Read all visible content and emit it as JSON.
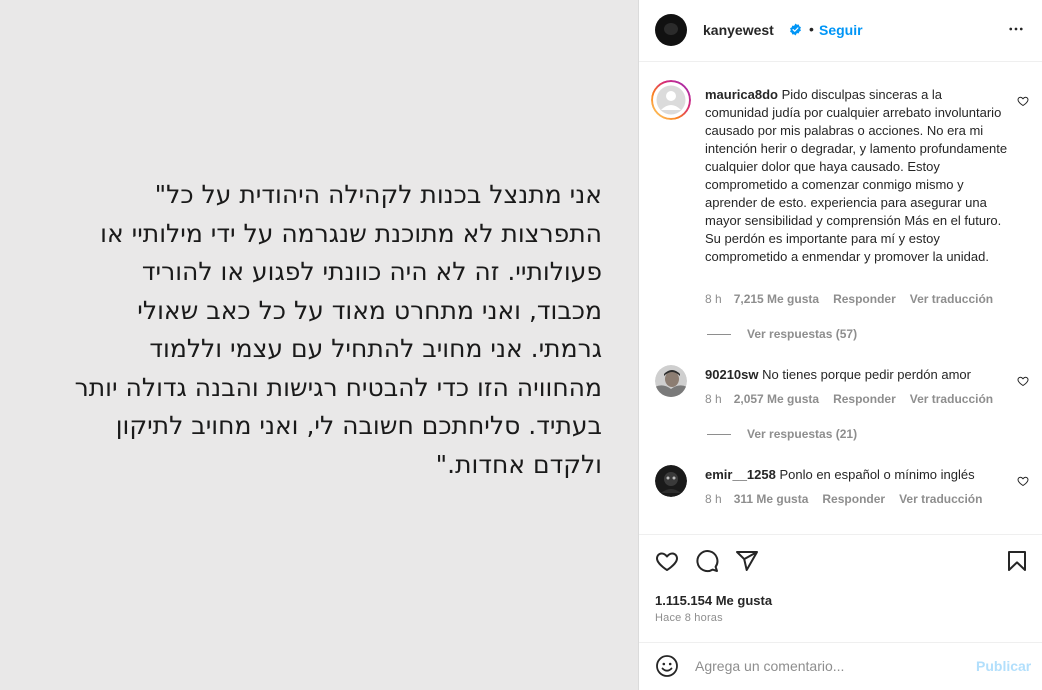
{
  "media": {
    "lines": [
      "אני מתנצל בכנות לקהילה היהודית על כל\"",
      "התפרצות לא מתוכנת שנגרמה על ידי מילותיי או",
      "פעולותיי. זה לא היה כוונתי לפגוע או להוריד",
      "מכבוד, ואני מתחרט מאוד על כל כאב שאולי",
      "גרמתי. אני מחויב להתחיל עם עצמי וללמוד",
      "מהחוויה הזו כדי להבטיח רגישות והבנה גדולה יותר",
      "בעתיד. סליחתכם חשובה לי, ואני מחויב לתיקון",
      "ולקדם אחדות.\""
    ]
  },
  "header": {
    "username": "kanyewest",
    "separator": "•",
    "follow_label": "Seguir",
    "verified_color": "#0095f6"
  },
  "comments": [
    {
      "username": "maurica8do",
      "text": "Pido disculpas sinceras a la comunidad judía por cualquier arrebato involuntario causado por mis palabras o acciones. No era mi intención herir o degradar, y lamento profundamente cualquier dolor que haya causado. Estoy comprometido a comenzar conmigo mismo y aprender de esto. experiencia para asegurar una mayor sensibilidad y comprensión Más en el futuro. Su perdón es importante para mí y estoy comprometido a enmendar y promover la unidad.",
      "time": "8 h",
      "likes": "7,215 Me gusta",
      "reply": "Responder",
      "translate": "Ver traducción",
      "replies": "Ver respuestas (57)"
    },
    {
      "username": "90210sw",
      "text": "No tienes porque pedir perdón amor",
      "time": "8 h",
      "likes": "2,057 Me gusta",
      "reply": "Responder",
      "translate": "Ver traducción",
      "replies": "Ver respuestas (21)"
    },
    {
      "username": "emir__1258",
      "text": "Ponlo en español o mínimo inglés",
      "time": "8 h",
      "likes": "311 Me gusta",
      "reply": "Responder",
      "translate": "Ver traducción"
    }
  ],
  "actions": {
    "likes_count": "1.115.154 Me gusta",
    "posted_ago": "Hace 8 horas"
  },
  "composer": {
    "placeholder": "Agrega un comentario...",
    "publish_label": "Publicar"
  },
  "colors": {
    "accent": "#0095f6",
    "muted": "#8e8e8e",
    "publish_disabled": "#b2dffc"
  }
}
